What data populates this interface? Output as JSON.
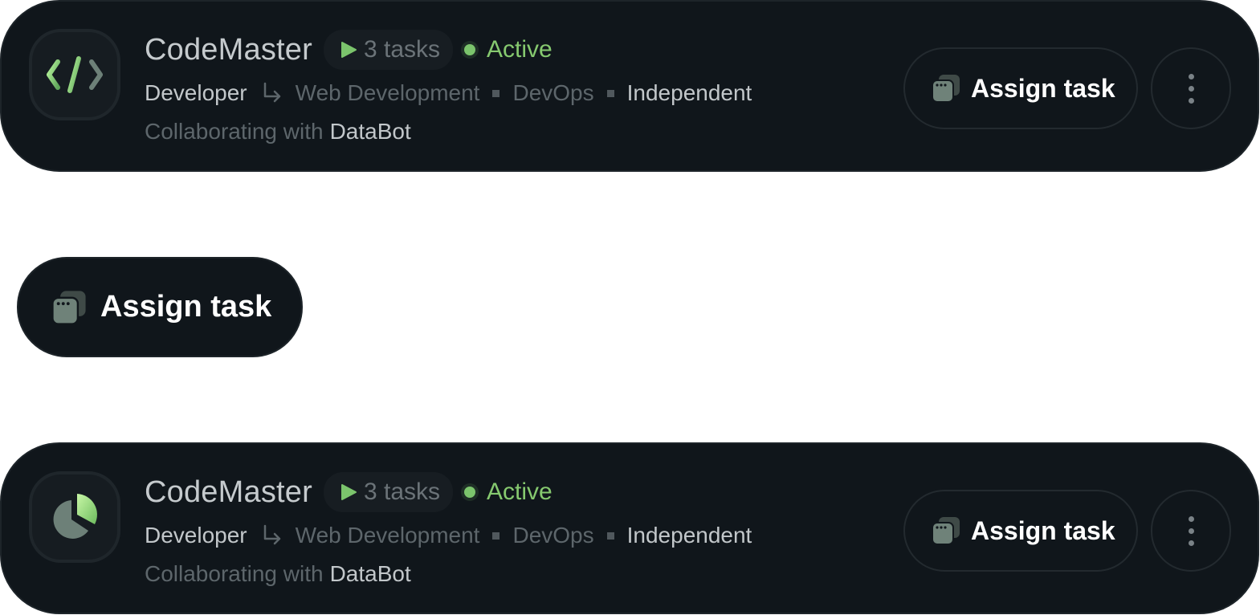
{
  "colors": {
    "card_bg": "#10161b",
    "accent_green": "#86c96f",
    "text_primary": "#c2c7ca",
    "text_dim": "#5d666b"
  },
  "assign_standalone": {
    "label": "Assign task",
    "icon": "task-stack-icon"
  },
  "cards": [
    {
      "avatar_icon": "code-icon",
      "name": "CodeMaster",
      "tasks_label": "3 tasks",
      "status": "Active",
      "role": "Developer",
      "specialties": [
        "Web Development",
        "DevOps"
      ],
      "mode": "Independent",
      "collab_prefix": "Collaborating with",
      "collab_partner": "DataBot",
      "assign_label": "Assign task",
      "more_icon": "kebab-menu-icon"
    },
    {
      "avatar_icon": "pie-chart-icon",
      "name": "CodeMaster",
      "tasks_label": "3 tasks",
      "status": "Active",
      "role": "Developer",
      "specialties": [
        "Web Development",
        "DevOps"
      ],
      "mode": "Independent",
      "collab_prefix": "Collaborating with",
      "collab_partner": "DataBot",
      "assign_label": "Assign task",
      "more_icon": "kebab-menu-icon"
    }
  ]
}
